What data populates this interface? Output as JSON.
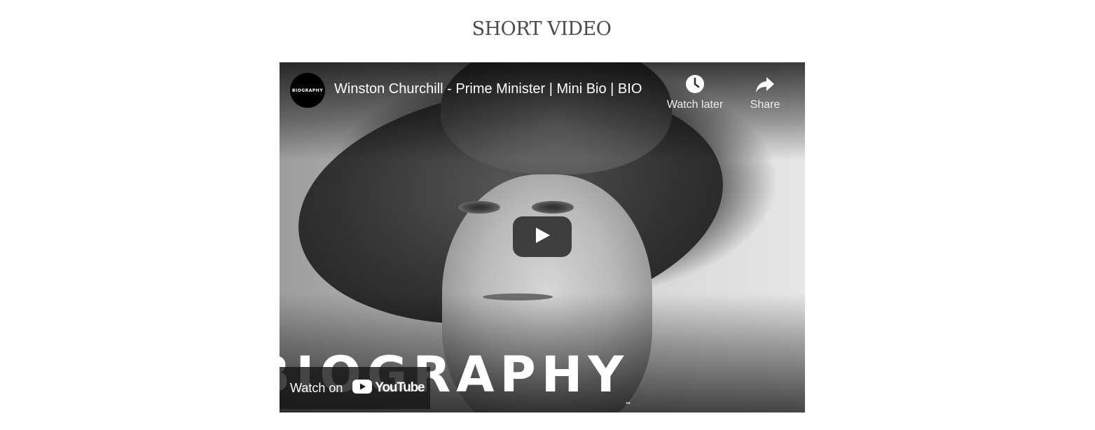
{
  "section": {
    "title": "SHORT VIDEO"
  },
  "player": {
    "channel_badge": "BIOGRAPHY",
    "video_title": "Winston Churchill - Prime Minister | Mini Bio | BIO",
    "watch_later_label": "Watch later",
    "share_label": "Share",
    "thumbnail_brand_text": "BIOGRAPHY",
    "thumbnail_brand_tm": "™",
    "watch_on_label": "Watch on",
    "youtube_wordmark": "YouTube"
  },
  "icons": {
    "watch_later": "clock-icon",
    "share": "share-arrow-icon",
    "play": "play-icon",
    "youtube": "youtube-logo-icon"
  },
  "colors": {
    "title_text": "#4a4a4a",
    "overlay_text": "#ffffff",
    "play_button_bg": "#212121"
  }
}
